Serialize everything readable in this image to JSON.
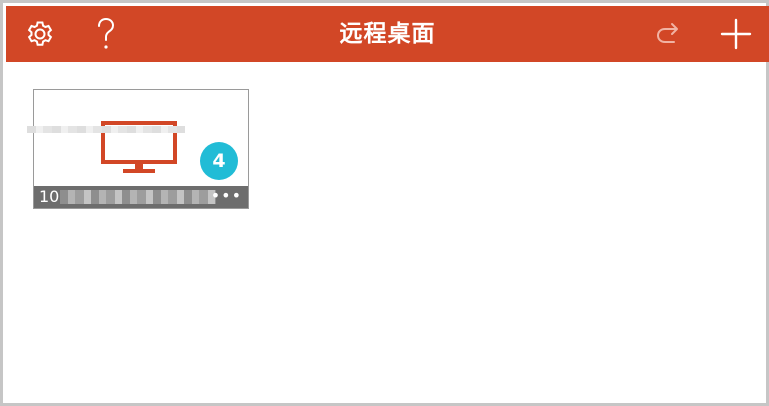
{
  "header": {
    "title": "远程桌面",
    "bar_color": "#d24726",
    "icons": {
      "settings": "gear-icon",
      "help": "question-mark-icon",
      "redo": "redo-arrow-icon",
      "add": "plus-icon"
    }
  },
  "desktops": [
    {
      "icon": "monitor-icon",
      "badge": "4",
      "badge_color": "#21bcd6",
      "label_visible": "10",
      "more_icon": "•••"
    }
  ]
}
